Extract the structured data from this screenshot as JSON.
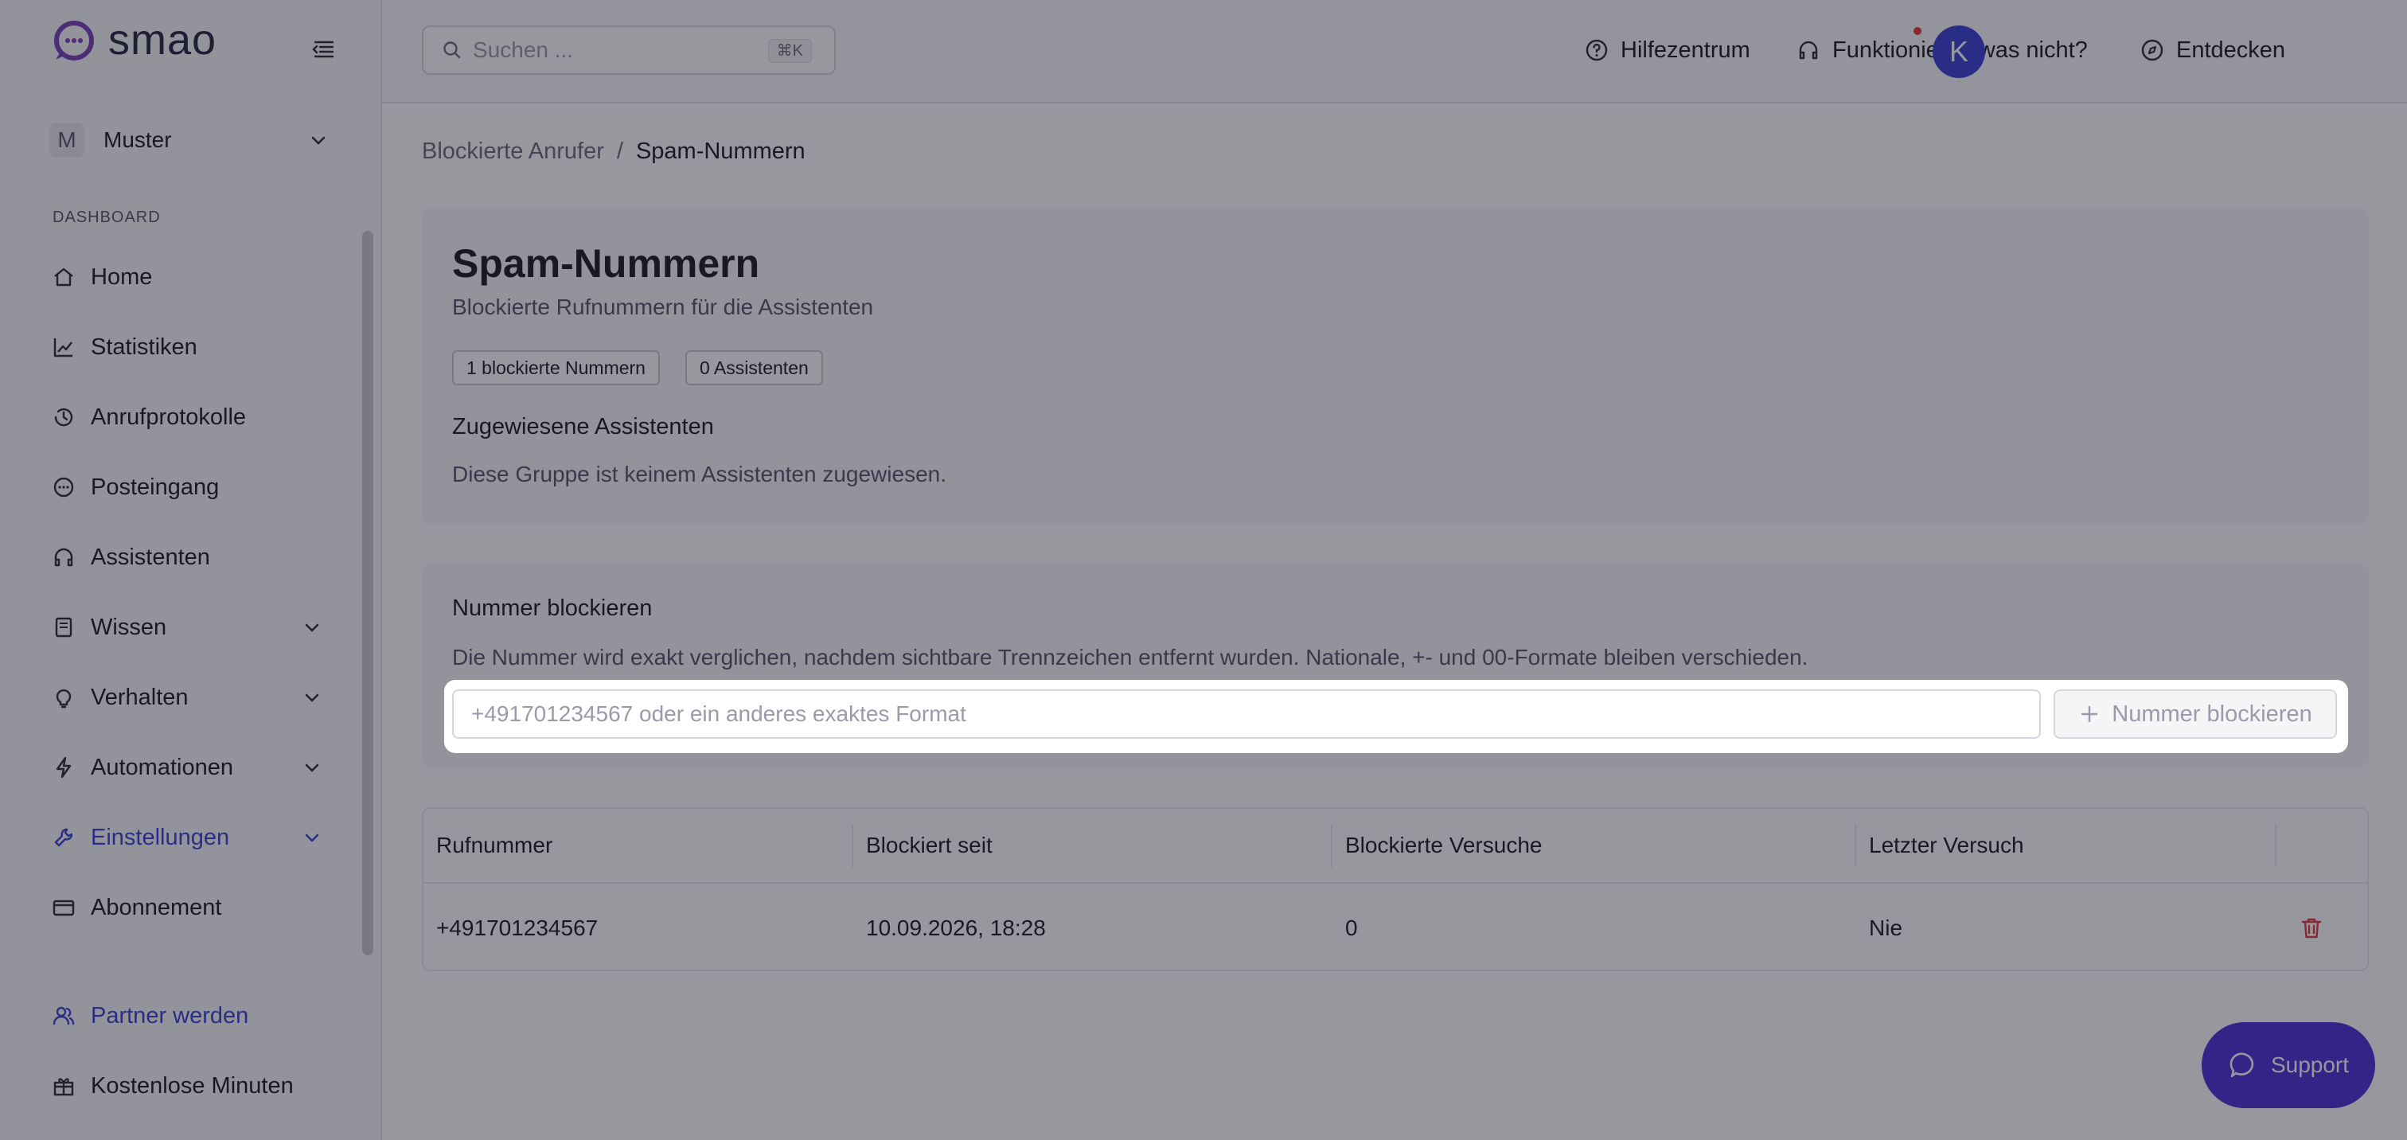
{
  "app": {
    "logo_text": "smao"
  },
  "sidebar": {
    "workspace": {
      "initial": "M",
      "name": "Muster"
    },
    "section_label": "DASHBOARD",
    "items": [
      {
        "label": "Home",
        "icon": "home-icon"
      },
      {
        "label": "Statistiken",
        "icon": "chart-line-icon"
      },
      {
        "label": "Anrufprotokolle",
        "icon": "history-icon"
      },
      {
        "label": "Posteingang",
        "icon": "chat-bubble-icon"
      },
      {
        "label": "Assistenten",
        "icon": "headphones-icon"
      },
      {
        "label": "Wissen",
        "icon": "book-icon"
      },
      {
        "label": "Verhalten",
        "icon": "lightbulb-icon"
      },
      {
        "label": "Automationen",
        "icon": "lightning-icon"
      },
      {
        "label": "Einstellungen",
        "icon": "wrench-icon"
      },
      {
        "label": "Abonnement",
        "icon": "credit-card-icon"
      }
    ],
    "bottom_items": [
      {
        "label": "Partner werden",
        "icon": "users-icon"
      },
      {
        "label": "Kostenlose Minuten",
        "icon": "gift-icon"
      }
    ]
  },
  "topbar": {
    "search_placeholder": "Suchen ...",
    "search_shortcut": "⌘K",
    "help_label": "Hilfezentrum",
    "issue_label": "Funktioniert etwas nicht?",
    "discover_label": "Entdecken",
    "user_initial": "K"
  },
  "breadcrumb": {
    "parent": "Blockierte Anrufer",
    "separator": "/",
    "current": "Spam-Nummern"
  },
  "info": {
    "title": "Spam-Nummern",
    "subtitle": "Blockierte Rufnummern für die Assistenten",
    "badge_blocked": "1 blockierte Nummern",
    "badge_assistants": "0 Assistenten",
    "assigned_heading": "Zugewiesene Assistenten",
    "assigned_text": "Diese Gruppe ist keinem Assistenten zugewiesen."
  },
  "block": {
    "heading": "Nummer blockieren",
    "description": "Die Nummer wird exakt verglichen, nachdem sichtbare Trennzeichen entfernt wurden. Nationale, +- und 00-Formate bleiben verschieden.",
    "input_placeholder": "+491701234567 oder ein anderes exaktes Format",
    "input_value": "",
    "button_label": "Nummer blockieren"
  },
  "table": {
    "columns": [
      "Rufnummer",
      "Blockiert seit",
      "Blockierte Versuche",
      "Letzter Versuch"
    ],
    "rows": [
      {
        "number": "+491701234567",
        "since": "10.09.2026, 18:28",
        "attempts": "0",
        "last": "Nie"
      }
    ]
  },
  "support_label": "Support",
  "colors": {
    "accent": "#3a3fd1",
    "support": "#4c2fd6",
    "danger": "#e03a3a"
  }
}
